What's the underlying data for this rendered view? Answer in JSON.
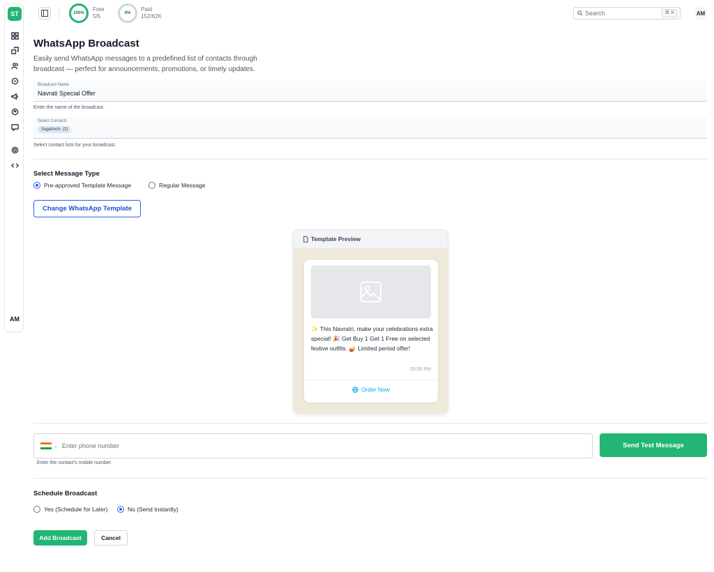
{
  "sidebar": {
    "logo": "ST",
    "avatar": "AM",
    "icons": [
      "dashboard-icon",
      "broadcast-icon",
      "contacts-icon",
      "chat-icon",
      "megaphone-icon",
      "message-icon",
      "comment-icon",
      "settings-icon",
      "code-icon"
    ]
  },
  "topbar": {
    "free": {
      "percent_label": "100%",
      "label": "Free",
      "count": "5/5"
    },
    "paid": {
      "percent_label": "0%",
      "label": "Paid",
      "count": "152/62K"
    },
    "search_placeholder": "Search",
    "search_shortcut": "⌘ K",
    "avatar": "AM"
  },
  "page": {
    "title": "WhatsApp Broadcast",
    "description": "Easily send WhatsApp messages to a predefined list of contacts through broadcast — perfect for announcements, promotions, or timely updates."
  },
  "form": {
    "broadcast_name": {
      "label": "Broadcast Name",
      "value": "Navrati Special Offer",
      "helper": "Enter the name of the broadcast."
    },
    "contacts": {
      "label": "Select Contacts",
      "chip": "Sagartech- (2)",
      "helper": "Select contact lists for your broadcast."
    },
    "message_type": {
      "heading": "Select Message Type",
      "options": [
        "Pre-approved Template Message",
        "Regular Message"
      ],
      "selected": "Pre-approved Template Message"
    },
    "change_template_label": "Change WhatsApp Template",
    "preview": {
      "heading": "Template Preview",
      "message": "✨ This Navratri, make your celebrations extra special! 🎉 Get Buy 1 Get 1 Free on selected festive outfits. 🪔 Limited period offer!",
      "time": "03:55 PM",
      "button_label": "Order Now"
    },
    "phone": {
      "placeholder": "Enter phone number",
      "helper": "Enter the contact's mobile number",
      "send_test_label": "Send Test Message"
    },
    "schedule": {
      "heading": "Schedule Broadcast",
      "options": [
        "Yes (Schedule for Later)",
        "No (Send Instantly)"
      ],
      "selected": "No (Send Instantly)"
    },
    "actions": {
      "submit_label": "Add Broadcast",
      "cancel_label": "Cancel"
    }
  },
  "colors": {
    "brand": "#22b573",
    "accent": "#2563eb"
  }
}
